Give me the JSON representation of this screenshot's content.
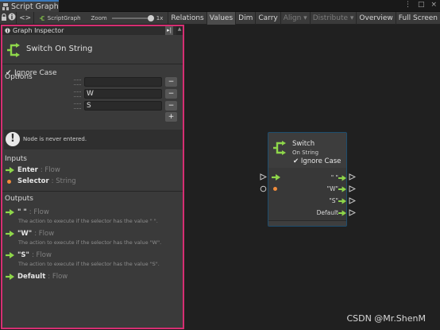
{
  "window": {
    "tab_title": "Script Graph",
    "menu_glyph": "⋮",
    "controls": [
      "□",
      "×"
    ]
  },
  "toolbar": {
    "lock_glyph": "🔒",
    "info_glyph": "i",
    "nav_glyph": "<>",
    "breadcrumb": "ScriptGraph",
    "zoom_label": "Zoom",
    "zoom_value": "1x",
    "zoom_level": 1.0,
    "buttons": [
      {
        "label": "Relations",
        "active": false,
        "enabled": true
      },
      {
        "label": "Values",
        "active": true,
        "enabled": true
      },
      {
        "label": "Dim",
        "active": false,
        "enabled": true
      },
      {
        "label": "Carry",
        "active": false,
        "enabled": true
      },
      {
        "label": "Align ▾",
        "active": false,
        "enabled": false
      },
      {
        "label": "Distribute ▾",
        "active": false,
        "enabled": false
      },
      {
        "label": "Overview",
        "active": false,
        "enabled": true
      },
      {
        "label": "Full Screen",
        "active": false,
        "enabled": true
      }
    ]
  },
  "inspector": {
    "header": "Graph Inspector",
    "pin_glyph": "▸|",
    "node_title": "Switch On String",
    "ignore_case_label": "Ignore Case",
    "ignore_case_checked": true,
    "check_glyph": "✔",
    "options_label": "Options",
    "options": [
      "",
      "W",
      "S"
    ],
    "minus_glyph": "−",
    "plus_glyph": "+",
    "warning": "Node is never entered.",
    "warning_glyph": "!",
    "inputs_title": "Inputs",
    "inputs": [
      {
        "name": "Enter",
        "type": ": Flow",
        "kind": "flow"
      },
      {
        "name": "Selector",
        "type": ": String",
        "kind": "value"
      }
    ],
    "outputs_title": "Outputs",
    "outputs": [
      {
        "name": "\" \"",
        "type": ": Flow",
        "desc": "The action to execute if the selector has the value \" \"."
      },
      {
        "name": "\"W\"",
        "type": ": Flow",
        "desc": "The action to execute if the selector has the value \"W\"."
      },
      {
        "name": "\"S\"",
        "type": ": Flow",
        "desc": "The action to execute if the selector has the value \"S\"."
      },
      {
        "name": "Default",
        "type": ": Flow",
        "desc": ""
      }
    ]
  },
  "graph_node": {
    "title": "Switch",
    "subtitle": "On String",
    "ignore_case_label": "Ignore Case",
    "ignore_case_checked": true,
    "check_glyph": "✔",
    "output_labels": [
      "\" \"",
      "\"W\"",
      "\"S\"",
      "Default"
    ]
  },
  "watermark": "CSDN @Mr.ShenM",
  "colors": {
    "flow_arrow": "#8ed64a",
    "value_port": "#f08c3c",
    "highlight_border": "#d62e72",
    "node_border": "#1d4d6e",
    "tab_accent": "#3a79bb"
  }
}
